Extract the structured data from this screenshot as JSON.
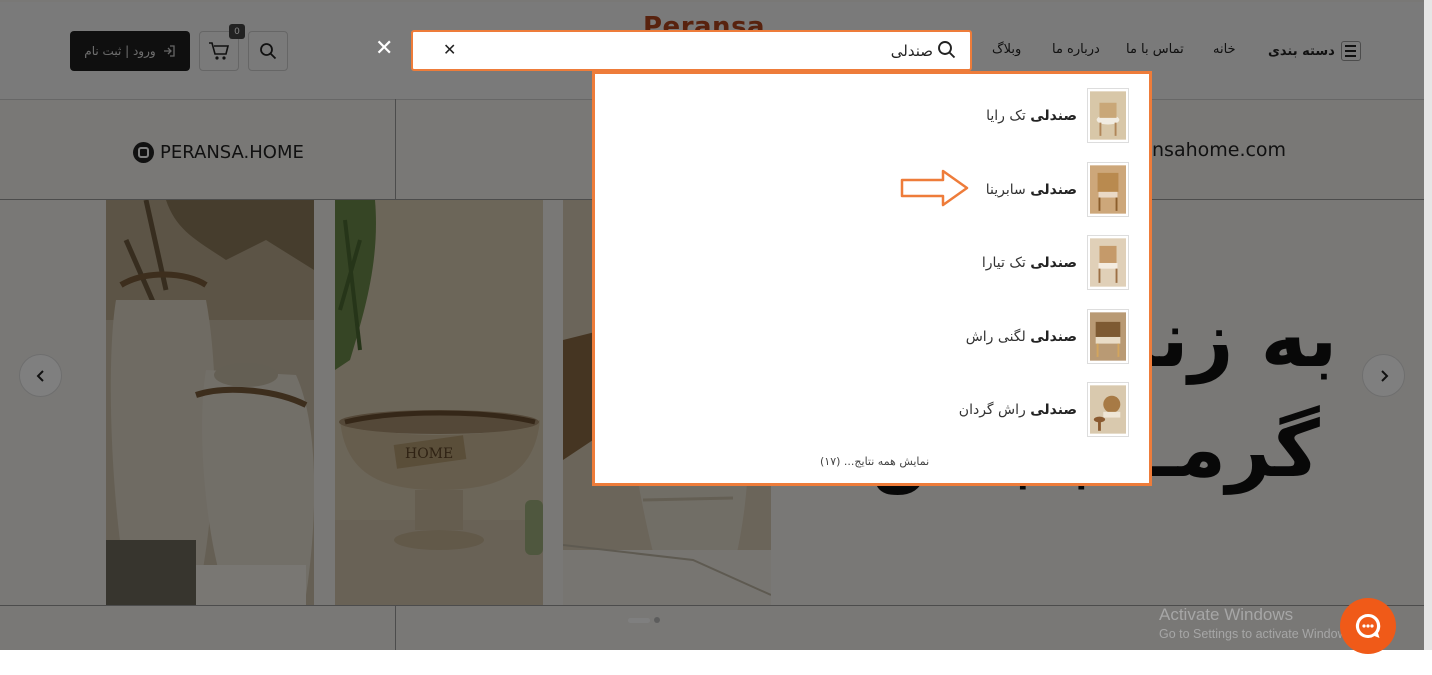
{
  "header": {
    "logo": "Peransa",
    "nav": {
      "categories": "دسته بندی",
      "home": "خانه",
      "contact": "تماس با ما",
      "about": "درباره ما",
      "blog": "وبلاگ"
    },
    "login_label": "ورود | ثبت نام",
    "cart_count": "0"
  },
  "info_strip": {
    "instagram": "PERANSA.HOME",
    "website": "nsahome.com"
  },
  "hero": {
    "line1": "به زنا",
    "line2": "گرمـ ـبـبـس"
  },
  "search": {
    "query": "صندلی",
    "results": [
      {
        "bold": "صندلی",
        "rest": " تک رایا"
      },
      {
        "bold": "صندلی",
        "rest": " سابرینا"
      },
      {
        "bold": "صندلی",
        "rest": " تک تیارا"
      },
      {
        "bold": "صندلی",
        "rest": " لگنی راش"
      },
      {
        "bold": "صندلی",
        "rest": " راش گردان"
      }
    ],
    "show_all": "نمایش همه نتایج... (۱۷)"
  },
  "os": {
    "activate_title": "Activate Windows",
    "activate_sub": "Go to Settings to activate Windows."
  },
  "colors": {
    "accent": "#ee7c3a",
    "logo": "#b0441c",
    "chat": "#f05a18"
  }
}
